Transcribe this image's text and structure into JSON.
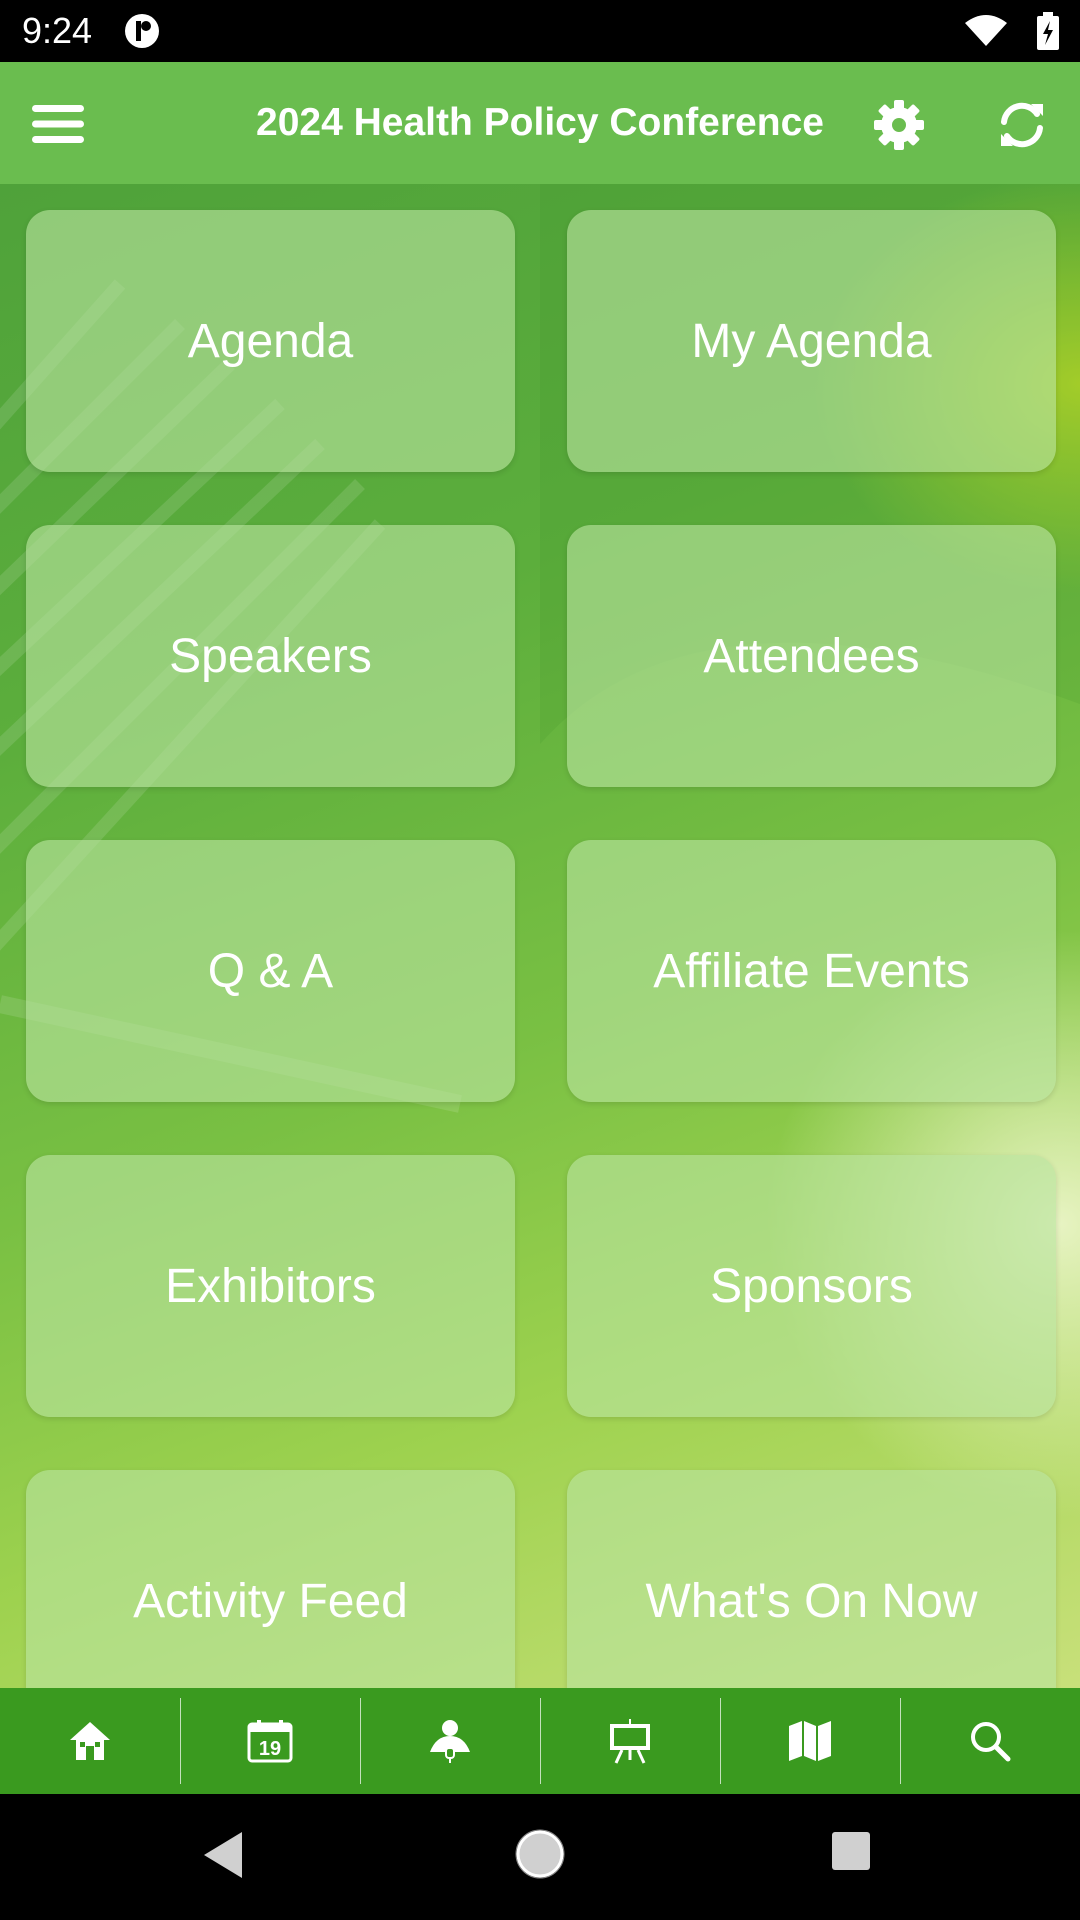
{
  "status_bar": {
    "time": "9:24"
  },
  "app_bar": {
    "title": "2024 Health Policy Conference",
    "menu_icon": "hamburger-menu-icon",
    "settings_icon": "gear-icon",
    "refresh_icon": "refresh-icon",
    "color": "#6abd4f"
  },
  "tiles": [
    {
      "label": "Agenda"
    },
    {
      "label": "My Agenda"
    },
    {
      "label": "Speakers"
    },
    {
      "label": "Attendees"
    },
    {
      "label": "Q & A"
    },
    {
      "label": "Affiliate Events"
    },
    {
      "label": "Exhibitors"
    },
    {
      "label": "Sponsors"
    },
    {
      "label": "Activity Feed"
    },
    {
      "label": "What's On Now"
    }
  ],
  "bottom_nav": {
    "color": "#3a9a1f",
    "items": [
      {
        "icon": "home-icon"
      },
      {
        "icon": "calendar-icon",
        "text": "19"
      },
      {
        "icon": "speaker-icon"
      },
      {
        "icon": "presentation-easel-icon"
      },
      {
        "icon": "map-icon"
      },
      {
        "icon": "search-icon"
      }
    ]
  },
  "system_nav": {
    "icons": [
      "back-icon",
      "home-circle-icon",
      "recents-icon"
    ]
  }
}
